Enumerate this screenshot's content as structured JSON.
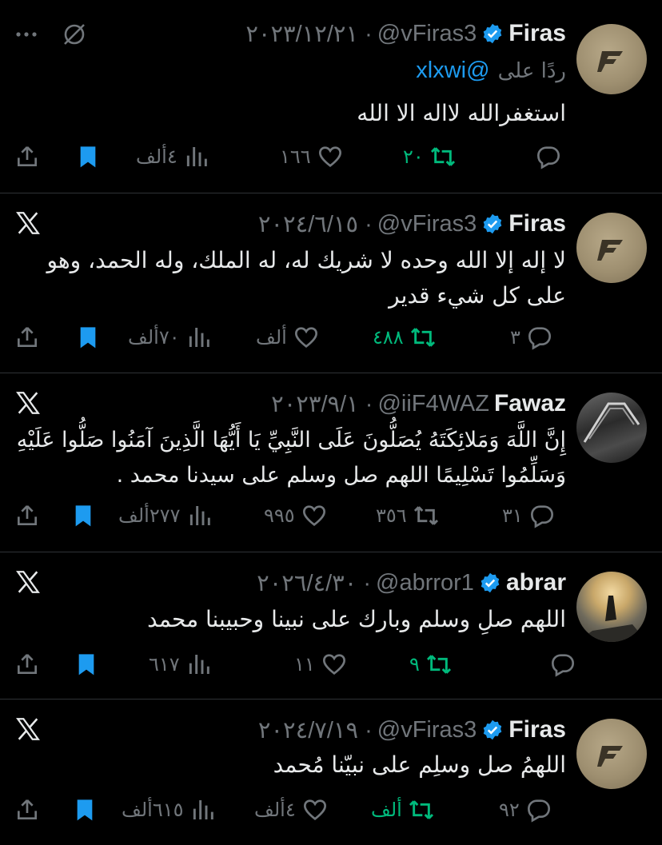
{
  "tweets": [
    {
      "name": "Firas",
      "handle": "@vFiras3",
      "date": "٢٠٢٣/١٢/٢١ ·",
      "reply_prefix": "ردًا على",
      "reply_to": "@xlxwi",
      "text": "استغفرالله لااله الا الله",
      "replies": "",
      "retweets": "٢٠",
      "likes": "١٦٦",
      "views": "٤ألف"
    },
    {
      "name": "Firas",
      "handle": "@vFiras3",
      "date": "٢٠٢٤/٦/١٥ ·",
      "text": "لا إله إلا الله وحده لا شريك له، له الملك، وله الحمد، وهو على كل شيء قدير",
      "replies": "٣",
      "retweets": "٤٨٨",
      "likes": "ألف",
      "views": "٧٠ألف"
    },
    {
      "name": "Fawaz",
      "handle": "@iiF4WAZ",
      "date": "٢٠٢٣/٩/١ ·",
      "text": "إِنَّ اللَّهَ وَمَلائِكَتَهُ يُصَلُّونَ عَلَى النَّبِيِّ يَا أَيُّهَا الَّذِينَ آمَنُوا صَلُّوا عَلَيْهِ وَسَلِّمُوا تَسْلِيمًا اللهم صل وسلم على سيدنا محمد .",
      "replies": "٣١",
      "retweets": "٣٥٦",
      "likes": "٩٩٥",
      "views": "٢٧٧ألف"
    },
    {
      "name": "abrar",
      "handle": "@abrror1",
      "date": "٢٠٢٦/٤/٣٠ ·",
      "text": "اللهم صلِ وسلم وبارك على نبينا وحبيبنا محمد",
      "replies": "",
      "retweets": "٩",
      "likes": "١١",
      "views": "٦١٧"
    },
    {
      "name": "Firas",
      "handle": "@vFiras3",
      "date": "٢٠٢٤/٧/١٩ ·",
      "text": "اللهمُ صل وسلِم على نبيّنا مُحمد",
      "replies": "٩٢",
      "retweets": "ألف",
      "likes": "٤ألف",
      "views": "٦١٥ألف"
    }
  ],
  "colors": {
    "background": "#000000",
    "text": "#e7e9ea",
    "muted": "#71767b",
    "accent": "#1d9bf0",
    "retweet_green": "#00ba7c",
    "divider": "#2f3336"
  }
}
